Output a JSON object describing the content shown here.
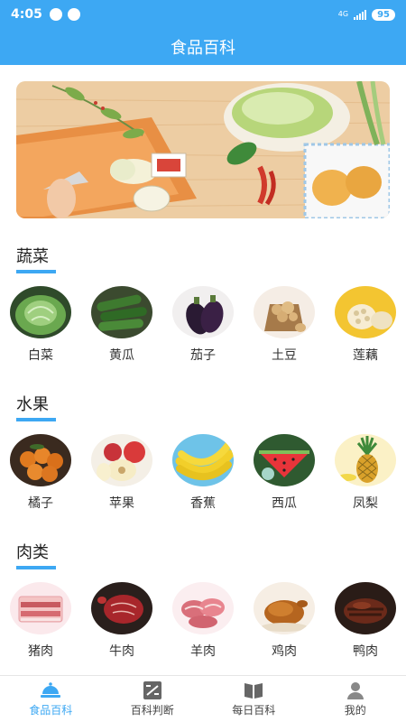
{
  "status": {
    "time": "4:05",
    "network": "4G",
    "battery": "95"
  },
  "header": {
    "title": "食品百科"
  },
  "sections": [
    {
      "title": "蔬菜",
      "items": [
        {
          "label": "白菜",
          "icon": "cabbage-image"
        },
        {
          "label": "黄瓜",
          "icon": "cucumber-image"
        },
        {
          "label": "茄子",
          "icon": "eggplant-image"
        },
        {
          "label": "土豆",
          "icon": "potato-image"
        },
        {
          "label": "莲藕",
          "icon": "lotus-root-image"
        }
      ]
    },
    {
      "title": "水果",
      "items": [
        {
          "label": "橘子",
          "icon": "orange-image"
        },
        {
          "label": "苹果",
          "icon": "apple-image"
        },
        {
          "label": "香蕉",
          "icon": "banana-image"
        },
        {
          "label": "西瓜",
          "icon": "watermelon-image"
        },
        {
          "label": "凤梨",
          "icon": "pineapple-image"
        }
      ]
    },
    {
      "title": "肉类",
      "items": [
        {
          "label": "猪肉",
          "icon": "pork-image"
        },
        {
          "label": "牛肉",
          "icon": "beef-image"
        },
        {
          "label": "羊肉",
          "icon": "mutton-image"
        },
        {
          "label": "鸡肉",
          "icon": "chicken-image"
        },
        {
          "label": "鸭肉",
          "icon": "duck-image"
        }
      ]
    }
  ],
  "tabs": [
    {
      "label": "食品百科",
      "icon": "food-dish-icon",
      "active": true
    },
    {
      "label": "百科判断",
      "icon": "judge-icon",
      "active": false
    },
    {
      "label": "每日百科",
      "icon": "book-icon",
      "active": false
    },
    {
      "label": "我的",
      "icon": "user-icon",
      "active": false
    }
  ],
  "colors": {
    "primary": "#3da8f3",
    "text": "#333333"
  }
}
